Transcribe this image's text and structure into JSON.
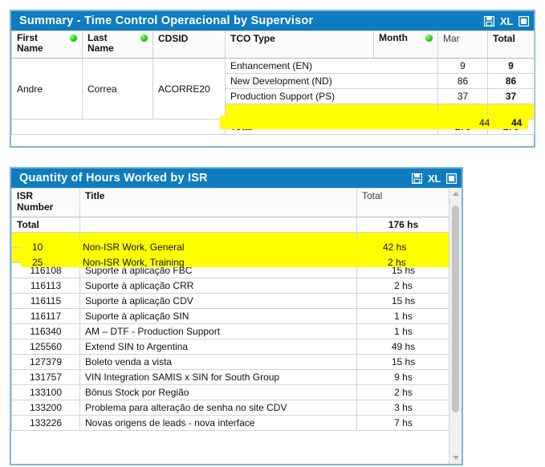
{
  "summary_panel": {
    "title": "Summary - Time Control Operacional by Supervisor",
    "icons": {
      "save": "save-icon",
      "excel": "XL",
      "window": "window-icon"
    },
    "columns": [
      {
        "label": "First\nName",
        "dot": true
      },
      {
        "label": "Last\nName",
        "dot": true
      },
      {
        "label": "CDSID",
        "dot": false
      },
      {
        "label": "TCO Type",
        "dot": false
      },
      {
        "label": "Month",
        "dot": true
      },
      {
        "label": "Mar",
        "dot": false
      },
      {
        "label": "Total",
        "dot": false
      }
    ],
    "person": {
      "first_name": "Andre",
      "last_name": "Correa",
      "cdsid": "ACORRE20"
    },
    "rows": [
      {
        "tco_type": "Enhancement (EN)",
        "mar": "9",
        "total": "9",
        "highlight": false
      },
      {
        "tco_type": "New Development (ND)",
        "mar": "86",
        "total": "86",
        "highlight": false
      },
      {
        "tco_type": "Production Support (PS)",
        "mar": "37",
        "total": "37",
        "highlight": false
      },
      {
        "tco_type": "",
        "mar": "44",
        "total": "44",
        "highlight": true
      }
    ],
    "total_row": {
      "label": "Total",
      "mar": "176",
      "total": "176"
    }
  },
  "isr_panel": {
    "title": "Quantity of Hours Worked by ISR",
    "icons": {
      "save": "save-icon",
      "excel": "XL",
      "window": "window-icon"
    },
    "columns": [
      {
        "label": "ISR\nNumber"
      },
      {
        "label": "Title"
      },
      {
        "label": "Total"
      }
    ],
    "total_row": {
      "label": "Total",
      "total": "176 hs"
    },
    "rows": [
      {
        "isr_number": "10",
        "title": "Non-ISR Work, General",
        "total": "42 hs",
        "highlight": true
      },
      {
        "isr_number": "25",
        "title": "Non-ISR Work, Training",
        "total": "2 hs",
        "highlight": true
      },
      {
        "isr_number": "116108",
        "title": "Suporte à aplicação FBC",
        "total": "15 hs",
        "highlight": false
      },
      {
        "isr_number": "116113",
        "title": "Suporte à aplicação CRR",
        "total": "2 hs",
        "highlight": false
      },
      {
        "isr_number": "116115",
        "title": "Suporte à aplicação CDV",
        "total": "15 hs",
        "highlight": false
      },
      {
        "isr_number": "116117",
        "title": "Suporte à aplicação SIN",
        "total": "1 hs",
        "highlight": false
      },
      {
        "isr_number": "116340",
        "title": "AM – DTF - Production Support",
        "total": "1 hs",
        "highlight": false
      },
      {
        "isr_number": "125560",
        "title": "Extend SIN to Argentina",
        "total": "49 hs",
        "highlight": false
      },
      {
        "isr_number": "127379",
        "title": "Boleto venda a vista",
        "total": "15 hs",
        "highlight": false
      },
      {
        "isr_number": "131757",
        "title": "VIN Integration SAMIS x SIN for South Group",
        "total": "9 hs",
        "highlight": false
      },
      {
        "isr_number": "133100",
        "title": "Bônus Stock por Região",
        "total": "2 hs",
        "highlight": false
      },
      {
        "isr_number": "133200",
        "title": "Problema para alteração de senha no site CDV",
        "total": "3 hs",
        "highlight": false
      },
      {
        "isr_number": "133226",
        "title": "Novas origens de leads - nova interface",
        "total": "7 hs",
        "highlight": false
      }
    ],
    "scrollbar": {
      "up": "▲",
      "down": "▼"
    }
  },
  "marker_text": {
    "summary_mar": "44",
    "summary_total": "44",
    "isr1_number": "10",
    "isr1_title": "Non-ISR Work, General",
    "isr1_total": "42 hs",
    "isr2_number": "25",
    "isr2_title": "Non-ISR Work, Training",
    "isr2_total": "2 hs"
  },
  "colors": {
    "title_blue": "#0f7cbf",
    "panel_border": "#7ab8d9",
    "highlight_yellow": "#ffff00",
    "dot_green": "#24cc14"
  }
}
